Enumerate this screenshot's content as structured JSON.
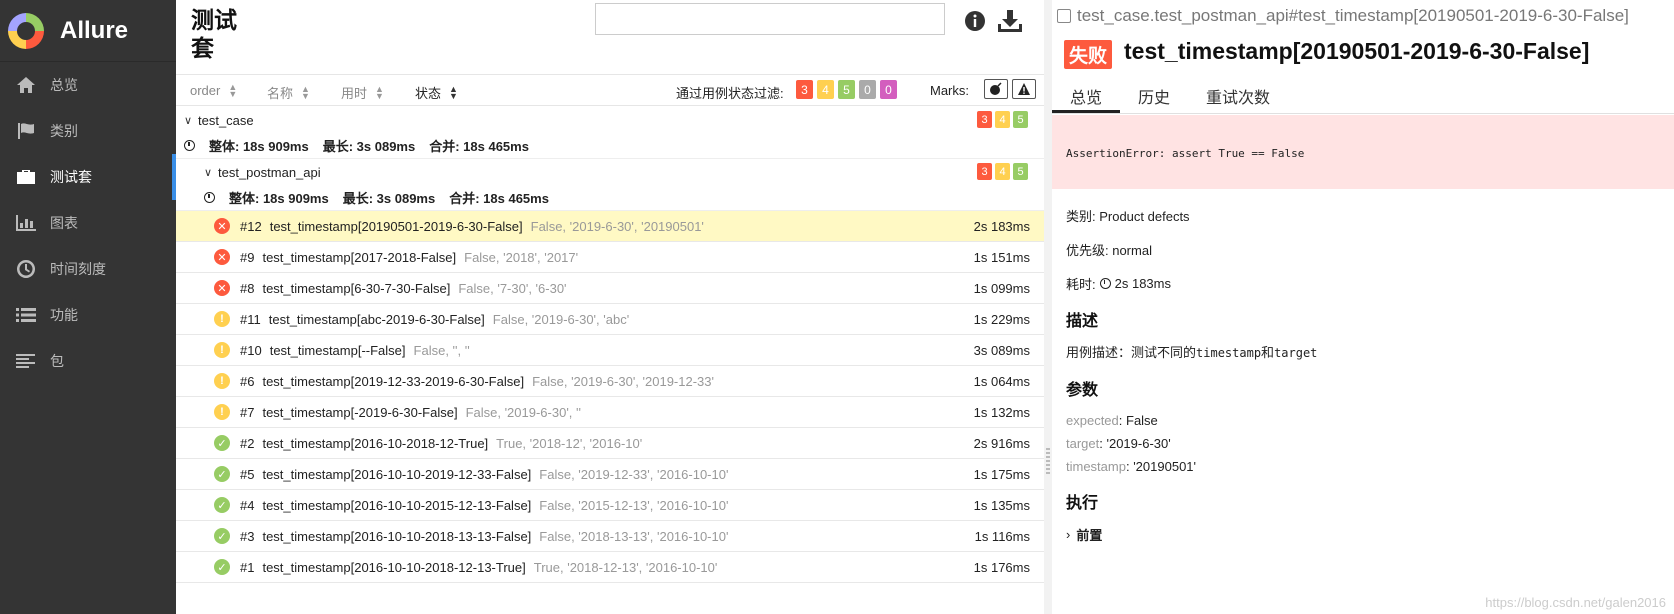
{
  "sidebar": {
    "app_name": "Allure",
    "items": [
      {
        "label": "总览",
        "icon": "home-icon"
      },
      {
        "label": "类别",
        "icon": "flag-icon"
      },
      {
        "label": "测试套",
        "icon": "briefcase-icon",
        "active": true
      },
      {
        "label": "图表",
        "icon": "bar-chart-icon"
      },
      {
        "label": "时间刻度",
        "icon": "clock-icon"
      },
      {
        "label": "功能",
        "icon": "list-icon"
      },
      {
        "label": "包",
        "icon": "align-left-icon"
      }
    ]
  },
  "suites": {
    "title": "测试套",
    "search_value": "",
    "toolbar": {
      "sort_order": "order",
      "sort_name": "名称",
      "sort_duration": "用时",
      "sort_status": "状态",
      "filter_label": "通过用例状态过滤:",
      "filter_badges": [
        {
          "value": "3",
          "color": "#fd5a3e"
        },
        {
          "value": "4",
          "color": "#ffd050"
        },
        {
          "value": "5",
          "color": "#97cc64"
        },
        {
          "value": "0",
          "color": "#aaaaaa"
        },
        {
          "value": "0",
          "color": "#d35ebe"
        }
      ],
      "marks_label": "Marks:"
    },
    "tree": {
      "root": {
        "name": "test_case",
        "counts": [
          "3",
          "4",
          "5"
        ],
        "stats_total": "整体: 18s 909ms",
        "stats_longest": "最长: 3s 089ms",
        "stats_combined": "合并: 18s 465ms"
      },
      "child": {
        "name": "test_postman_api",
        "counts": [
          "3",
          "4",
          "5"
        ],
        "stats_total": "整体: 18s 909ms",
        "stats_longest": "最长: 3s 089ms",
        "stats_combined": "合并: 18s 465ms"
      },
      "tests": [
        {
          "num": "#12",
          "name": "test_timestamp[20190501-2019-6-30-False]",
          "params": "False, '2019-6-30', '20190501'",
          "duration": "2s 183ms",
          "status": "failed",
          "selected": true
        },
        {
          "num": "#9",
          "name": "test_timestamp[2017-2018-False]",
          "params": "False, '2018', '2017'",
          "duration": "1s 151ms",
          "status": "failed"
        },
        {
          "num": "#8",
          "name": "test_timestamp[6-30-7-30-False]",
          "params": "False, '7-30', '6-30'",
          "duration": "1s 099ms",
          "status": "failed"
        },
        {
          "num": "#11",
          "name": "test_timestamp[abc-2019-6-30-False]",
          "params": "False, '2019-6-30', 'abc'",
          "duration": "1s 229ms",
          "status": "broken"
        },
        {
          "num": "#10",
          "name": "test_timestamp[--False]",
          "params": "False, '', ''",
          "duration": "3s 089ms",
          "status": "broken"
        },
        {
          "num": "#6",
          "name": "test_timestamp[2019-12-33-2019-6-30-False]",
          "params": "False, '2019-6-30', '2019-12-33'",
          "duration": "1s 064ms",
          "status": "broken"
        },
        {
          "num": "#7",
          "name": "test_timestamp[-2019-6-30-False]",
          "params": "False, '2019-6-30', ''",
          "duration": "1s 132ms",
          "status": "broken"
        },
        {
          "num": "#2",
          "name": "test_timestamp[2016-10-2018-12-True]",
          "params": "True, '2018-12', '2016-10'",
          "duration": "2s 916ms",
          "status": "passed"
        },
        {
          "num": "#5",
          "name": "test_timestamp[2016-10-10-2019-12-33-False]",
          "params": "False, '2019-12-33', '2016-10-10'",
          "duration": "1s 175ms",
          "status": "passed"
        },
        {
          "num": "#4",
          "name": "test_timestamp[2016-10-10-2015-12-13-False]",
          "params": "False, '2015-12-13', '2016-10-10'",
          "duration": "1s 135ms",
          "status": "passed"
        },
        {
          "num": "#3",
          "name": "test_timestamp[2016-10-10-2018-13-13-False]",
          "params": "False, '2018-13-13', '2016-10-10'",
          "duration": "1s 116ms",
          "status": "passed"
        },
        {
          "num": "#1",
          "name": "test_timestamp[2016-10-10-2018-12-13-True]",
          "params": "True, '2018-12-13', '2016-10-10'",
          "duration": "1s 176ms",
          "status": "passed"
        }
      ]
    }
  },
  "detail": {
    "breadcrumb": "test_case.test_postman_api#test_timestamp[20190501-2019-6-30-False]",
    "status_label": "失败",
    "title": "test_timestamp[20190501-2019-6-30-False]",
    "tabs": [
      "总览",
      "历史",
      "重试次数"
    ],
    "error": "AssertionError: assert True == False",
    "category": "类别: Product defects",
    "severity": "优先级: normal",
    "duration_label": "耗时:",
    "duration_value": "2s 183ms",
    "description_title": "描述",
    "description_prefix": "用例描述：测试不同的",
    "description_code1": "timestamp",
    "description_mid": "和",
    "description_code2": "target",
    "params_title": "参数",
    "params": [
      {
        "key": "expected",
        "value": "False"
      },
      {
        "key": "target",
        "value": "'2019-6-30'"
      },
      {
        "key": "timestamp",
        "value": "'20190501'"
      }
    ],
    "execution_title": "执行",
    "setup_label": "前置"
  },
  "watermark": "https://blog.csdn.net/galen2016",
  "colors": {
    "failed": "#fd5a3e",
    "broken": "#ffd050",
    "passed": "#97cc64",
    "selected_row": "#fff9c4",
    "error_bg": "#ffe3e3"
  }
}
